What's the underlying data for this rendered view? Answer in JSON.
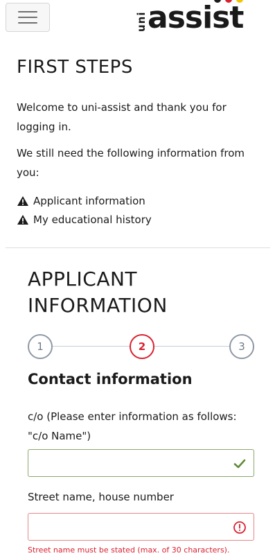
{
  "header": {
    "menu_icon": "hamburger-menu-icon",
    "logo": {
      "prefix": "uni",
      "name": "assist",
      "dot_colors": [
        "#1a1a1a",
        "#d9202f",
        "#f2c500"
      ]
    }
  },
  "first_steps": {
    "title": "FIRST STEPS",
    "welcome": "Welcome to uni-assist and thank you for logging in.",
    "still_need": "We still need the following information from you:",
    "requirements": [
      {
        "icon": "warning-icon",
        "label": "Applicant information"
      },
      {
        "icon": "warning-icon",
        "label": "My educational history"
      }
    ]
  },
  "applicant": {
    "title_line1": "APPLICANT",
    "title_line2": "INFORMATION",
    "steps": [
      {
        "number": "1",
        "active": false
      },
      {
        "number": "2",
        "active": true
      },
      {
        "number": "3",
        "active": false
      }
    ],
    "section_title": "Contact information",
    "fields": {
      "co_label": "c/o (Please enter information as follows: \"c/o Name\")",
      "co_value": "",
      "co_status_icon": "checkmark-icon",
      "street_label": "Street name, house number",
      "street_value": "",
      "street_status_icon": "error-circle-icon",
      "street_error": "Street name must be stated (max. of 30 characters)."
    }
  },
  "colors": {
    "accent_red": "#d9202f",
    "valid_green": "#8aa76a",
    "invalid_border": "#e4868b"
  }
}
